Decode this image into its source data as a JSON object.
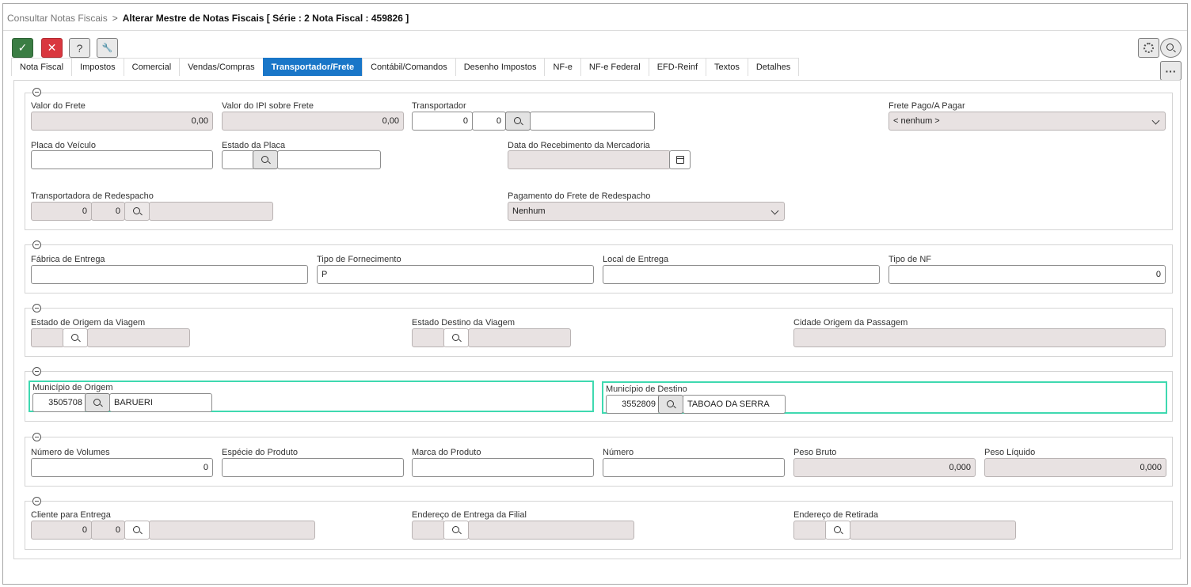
{
  "breadcrumb": {
    "parent": "Consultar Notas Fiscais",
    "separator": ">",
    "current": "Alterar Mestre de Notas Fiscais [ Série : 2 Nota Fiscal : 459826 ]"
  },
  "toolbar": {
    "confirm": "✓",
    "cancel": "✕",
    "help": "?",
    "tools": "🔧",
    "more": "···"
  },
  "tabs": [
    "Nota Fiscal",
    "Impostos",
    "Comercial",
    "Vendas/Compras",
    "Transportador/Frete",
    "Contábil/Comandos",
    "Desenho Impostos",
    "NF-e",
    "NF-e Federal",
    "EFD-Reinf",
    "Textos",
    "Detalhes"
  ],
  "active_tab": "Transportador/Frete",
  "s1": {
    "valor_frete": {
      "label": "Valor do Frete",
      "value": "0,00"
    },
    "valor_ipi": {
      "label": "Valor do IPI sobre Frete",
      "value": "0,00"
    },
    "transportador": {
      "label": "Transportador",
      "code1": "0",
      "code2": "0",
      "name": ""
    },
    "frete_pago": {
      "label": "Frete Pago/A Pagar",
      "value": "< nenhum >"
    },
    "placa": {
      "label": "Placa do Veículo",
      "value": ""
    },
    "estado_placa": {
      "label": "Estado da Placa",
      "value": ""
    },
    "data_receb": {
      "label": "Data do Recebimento da Mercadoria",
      "value": ""
    },
    "redespacho": {
      "label": "Transportadora de Redespacho",
      "code1": "0",
      "code2": "0"
    },
    "pag_redespacho": {
      "label": "Pagamento do Frete de Redespacho",
      "value": "Nenhum"
    }
  },
  "s2": {
    "fabrica": {
      "label": "Fábrica de Entrega",
      "value": ""
    },
    "tipo_fornec": {
      "label": "Tipo de Fornecimento",
      "value": "P"
    },
    "local": {
      "label": "Local de Entrega",
      "value": ""
    },
    "tipo_nf": {
      "label": "Tipo de NF",
      "value": "0"
    }
  },
  "s3": {
    "origem_viagem": {
      "label": "Estado de Origem da Viagem"
    },
    "destino_viagem": {
      "label": "Estado Destino da Viagem"
    },
    "cidade_origem": {
      "label": "Cidade Origem da Passagem"
    }
  },
  "s4": {
    "mun_origem": {
      "label": "Município de Origem",
      "code": "3505708",
      "name": "BARUERI"
    },
    "mun_destino": {
      "label": "Município de Destino",
      "code": "3552809",
      "name": "TABOAO DA SERRA"
    }
  },
  "s5": {
    "volumes": {
      "label": "Número de Volumes",
      "value": "0"
    },
    "especie": {
      "label": "Espécie do Produto",
      "value": ""
    },
    "marca": {
      "label": "Marca do Produto",
      "value": ""
    },
    "numero": {
      "label": "Número",
      "value": ""
    },
    "peso_bruto": {
      "label": "Peso Bruto",
      "value": "0,000"
    },
    "peso_liquido": {
      "label": "Peso Líquido",
      "value": "0,000"
    }
  },
  "s6": {
    "cliente": {
      "label": "Cliente para Entrega",
      "code1": "0",
      "code2": "0"
    },
    "end_filial": {
      "label": "Endereço de Entrega da Filial"
    },
    "end_retirada": {
      "label": "Endereço de Retirada"
    }
  },
  "colors": {
    "accent": "#1976c8",
    "confirm": "#3b7d44",
    "cancel": "#d9373f",
    "highlight": "#3fd9b0",
    "readonly": "#e8e2e2"
  }
}
